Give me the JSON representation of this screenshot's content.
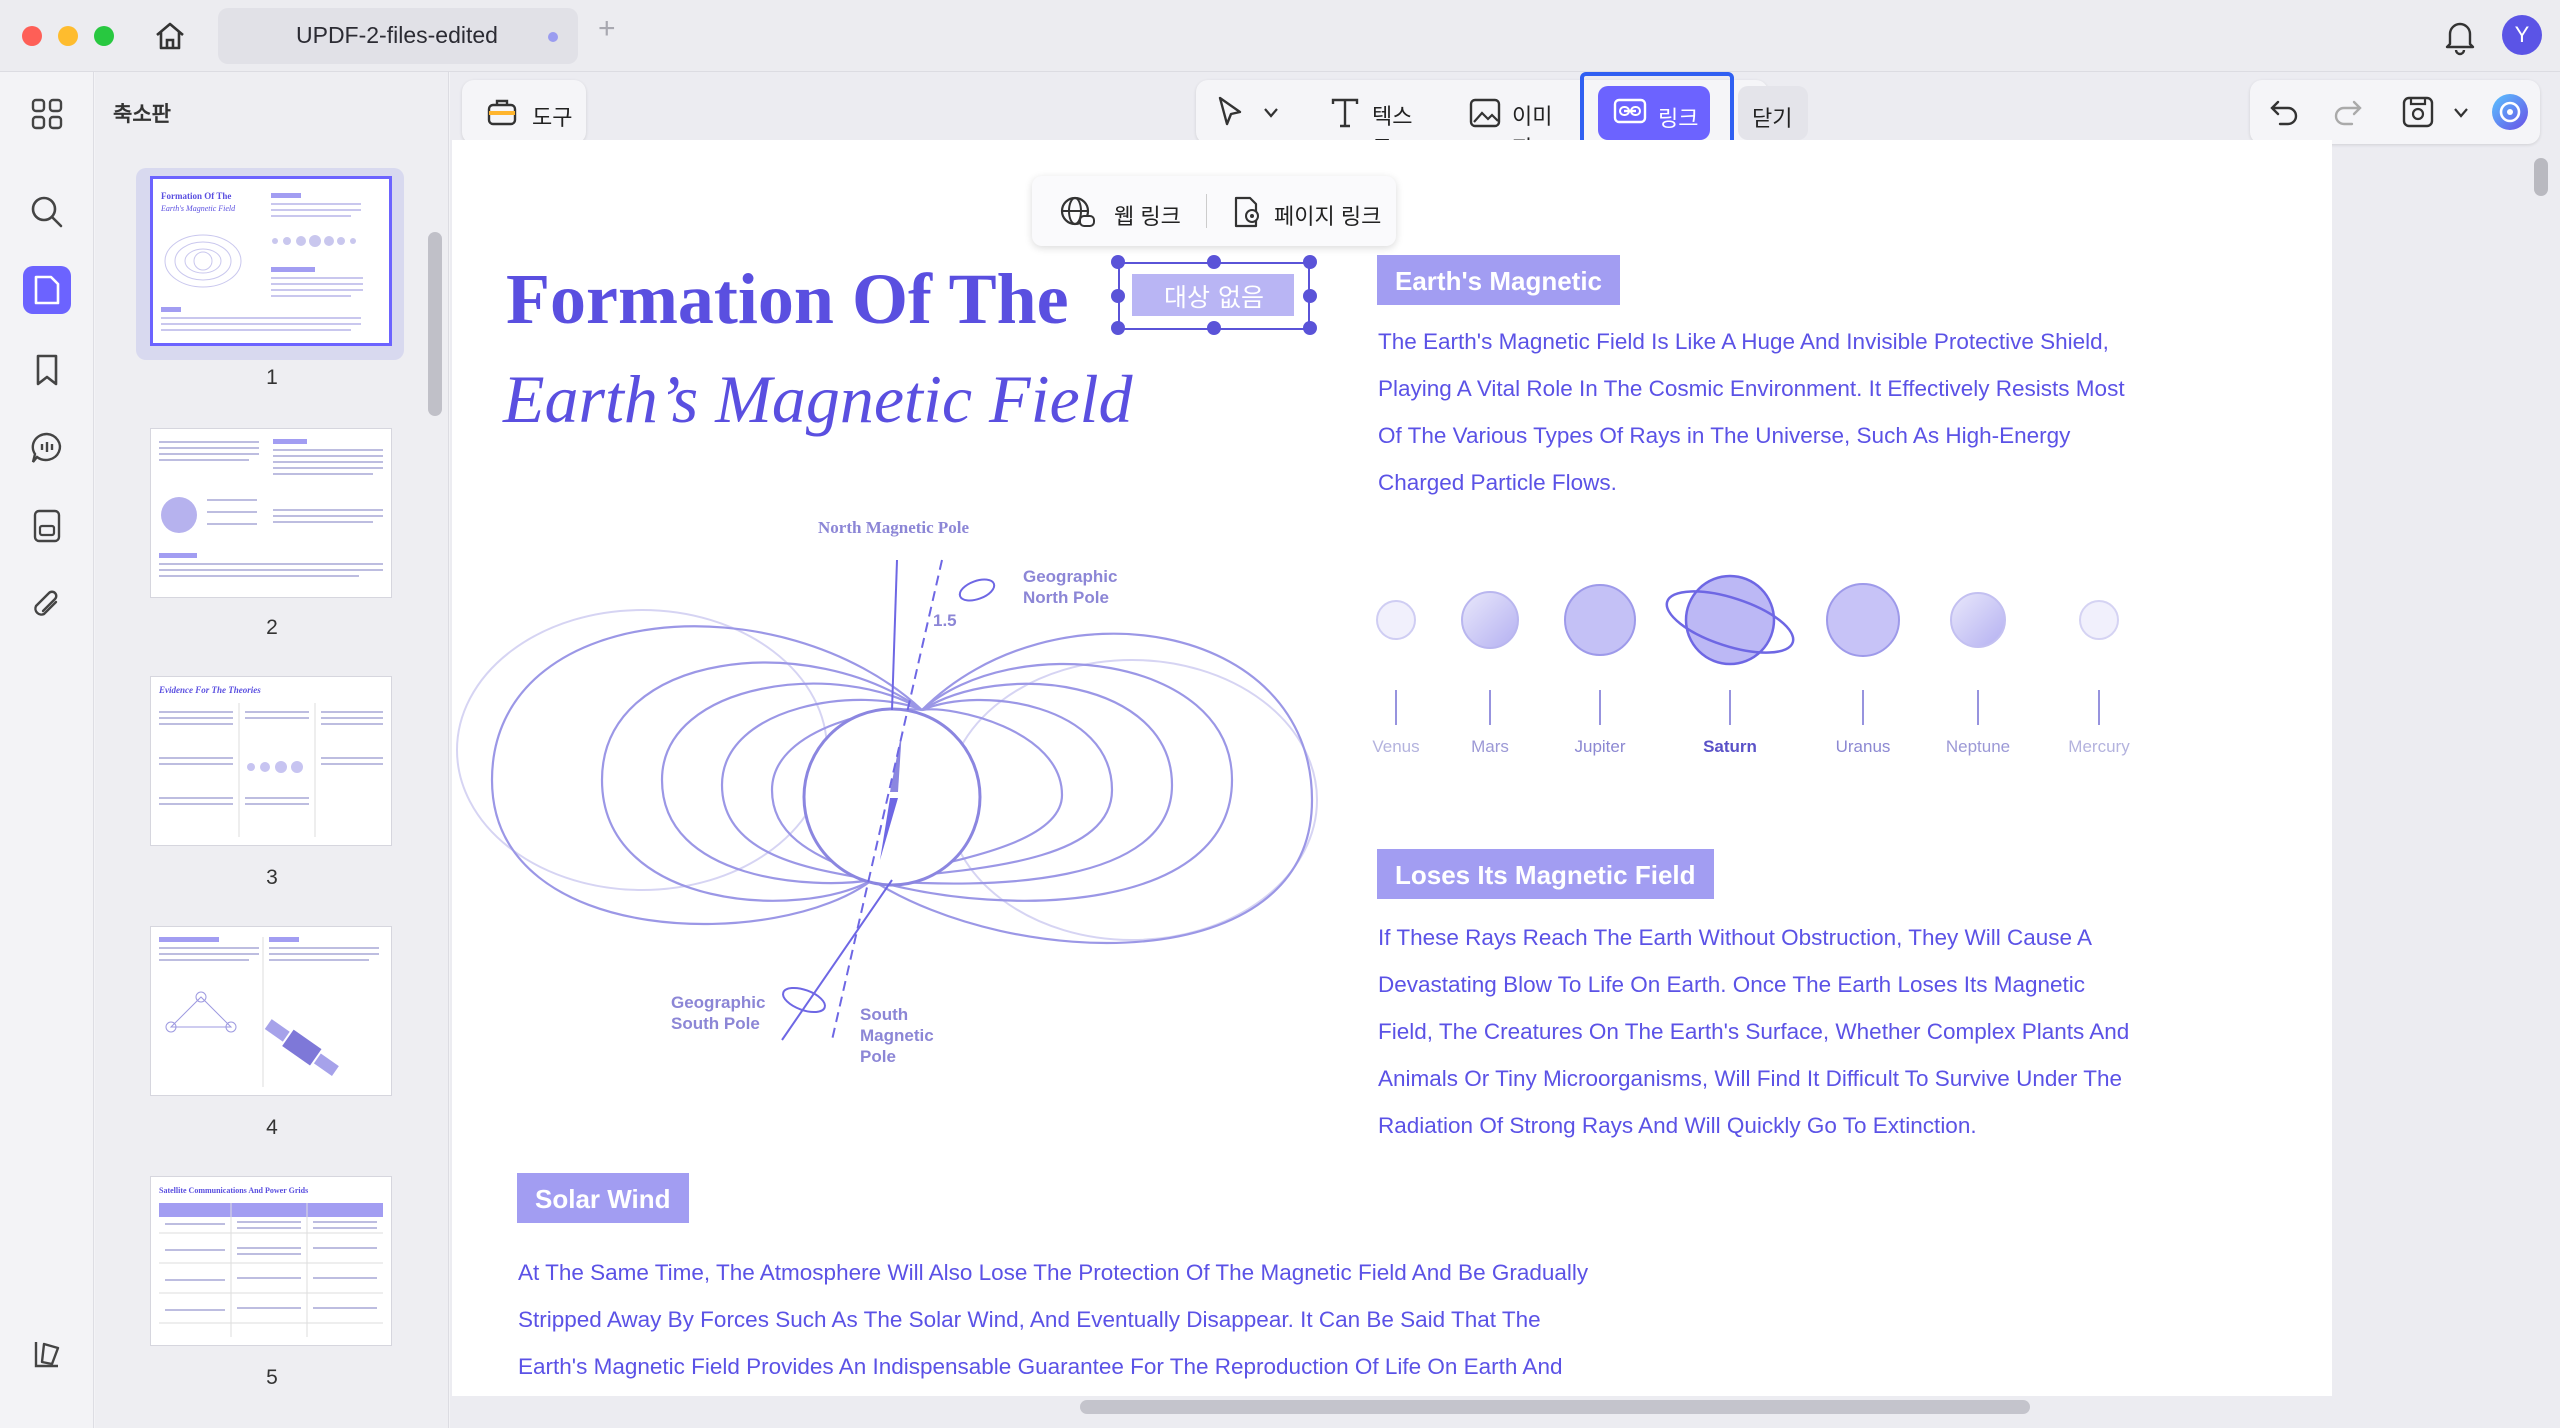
{
  "window": {
    "tab_title": "UPDF-2-files-edited",
    "avatar_letter": "Y"
  },
  "sidebar": {
    "title": "축소판",
    "pages": [
      "1",
      "2",
      "3",
      "4",
      "5"
    ]
  },
  "toolbar": {
    "tools_label": "도구",
    "text_label": "텍스트",
    "image_label": "이미지",
    "link_label": "링크",
    "close_label": "닫기"
  },
  "link_popup": {
    "web_link": "웹 링크",
    "page_link": "페이지 링크"
  },
  "link_box_text": "대상 없음",
  "document": {
    "title_line1": "Formation Of The",
    "title_line2": "Earth’s Magnetic Field",
    "section1": {
      "heading": "Earth's Magnetic",
      "lines": [
        "The Earth's Magnetic Field Is Like A Huge And Invisible Protective Shield,",
        "Playing A Vital Role In The Cosmic Environment. It Effectively Resists Most",
        "Of The Various Types Of Rays in The Universe, Such As High-Energy",
        "Charged Particle Flows."
      ]
    },
    "planets": [
      "Venus",
      "Mars",
      "Jupiter",
      "Saturn",
      "Uranus",
      "Neptune",
      "Mercury"
    ],
    "diagram_labels": {
      "north_magnetic": "North Magnetic Pole",
      "geo_north": "Geographic North Pole",
      "tilt": "1.5",
      "geo_south": "Geographic South Pole",
      "south_magnetic": "South Magnetic Pole"
    },
    "section2": {
      "heading": "Loses Its Magnetic Field",
      "lines": [
        "If These Rays Reach The Earth Without Obstruction, They Will Cause A",
        "Devastating Blow To Life On Earth. Once The Earth Loses Its Magnetic",
        "Field, The Creatures On The Earth's Surface, Whether Complex Plants And",
        "Animals Or Tiny Microorganisms, Will Find It Difficult To Survive Under The",
        "Radiation Of Strong Rays And Will Quickly Go To Extinction."
      ]
    },
    "section3": {
      "heading": "Solar Wind",
      "lines": [
        "At The Same Time, The Atmosphere Will Also Lose The Protection Of The Magnetic Field And Be Gradually",
        "Stripped Away By Forces Such As The Solar Wind, And Eventually Disappear. It Can Be Said That The",
        "Earth's Magnetic Field Provides An Indispensable Guarantee For The Reproduction Of Life On Earth And"
      ]
    }
  },
  "colors": {
    "accent": "#6c63ff",
    "heading": "#5a4fe0",
    "section_bg": "#a29df2"
  }
}
